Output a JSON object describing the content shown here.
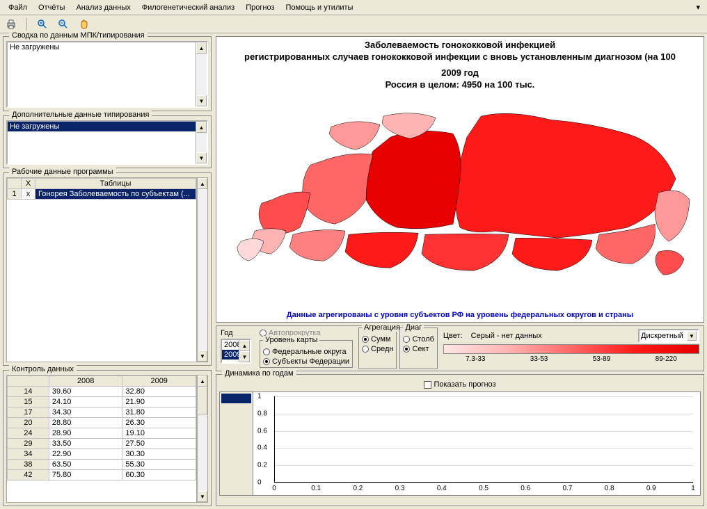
{
  "menubar": [
    "Файл",
    "Отчёты",
    "Анализ данных",
    "Филогенетический анализ",
    "Прогноз",
    "Помощь и утилиты"
  ],
  "panels": {
    "mpk": {
      "title": "Сводка по данным МПК/типирования",
      "item": "Не загружены"
    },
    "additional": {
      "title": "Дополнительные данные типирования",
      "item": "Не загружены"
    },
    "workdata": {
      "title": "Рабочие данные программы",
      "headers": [
        "",
        "X",
        "Таблицы"
      ],
      "row": [
        "1",
        "x",
        "Гонорея Заболеваемость по субъектам (..."
      ]
    },
    "control": {
      "title": "Контроль данных",
      "year_headers": [
        "2008",
        "2009"
      ],
      "rows": [
        [
          "14",
          "39.60",
          "32.80"
        ],
        [
          "15",
          "24.10",
          "21.90"
        ],
        [
          "17",
          "34.30",
          "31.80"
        ],
        [
          "20",
          "28.80",
          "26.30"
        ],
        [
          "24",
          "28.90",
          "19.10"
        ],
        [
          "29",
          "33.50",
          "27.50"
        ],
        [
          "34",
          "22.90",
          "30.30"
        ],
        [
          "38",
          "63.50",
          "55.30"
        ],
        [
          "42",
          "75.80",
          "60.30"
        ]
      ]
    }
  },
  "map": {
    "title1": "Заболеваемость гонококковой инфекцией",
    "title2": "регистрированных случаев гонококковой инфекции с вновь установленным диагнозом (на 100",
    "year": "2009 год",
    "total": "Россия в целом: 4950 на 100 тыс.",
    "note": "Данные агрегированы с уровня субъектов РФ на уровень федеральных округов и страны"
  },
  "controls": {
    "year_label": "Год",
    "years": [
      "2008",
      "2009"
    ],
    "autoplay": "Автопрокрутка",
    "map_level": {
      "title": "Уровень карты",
      "opt1": "Федеральные округа",
      "opt2": "Субъекты Федерации"
    },
    "aggregation": {
      "title": "Агрегация",
      "opt1": "Сумм",
      "opt2": "Средн"
    },
    "diag": {
      "title": "Диаг",
      "opt1": "Столб",
      "opt2": "Сект"
    },
    "color_label": "Цвет:",
    "grey_note": "Серый - нет данных",
    "mode": "Дискретный",
    "legend_ticks": [
      "7.3-33",
      "33-53",
      "53-89",
      "89-220"
    ]
  },
  "dynamics": {
    "title": "Динамика по годам",
    "show_forecast": "Показать прогноз",
    "y_ticks": [
      "1",
      "0.8",
      "0.6",
      "0.4",
      "0.2",
      "0"
    ],
    "x_ticks": [
      "0",
      "0.1",
      "0.2",
      "0.3",
      "0.4",
      "0.5",
      "0.6",
      "0.7",
      "0.8",
      "0.9",
      "1"
    ]
  },
  "chart_data": {
    "type": "line",
    "title": "Динамика по годам",
    "x": [],
    "series": [],
    "xlim": [
      0,
      1
    ],
    "ylim": [
      0,
      1
    ],
    "xlabel": "",
    "ylabel": ""
  }
}
